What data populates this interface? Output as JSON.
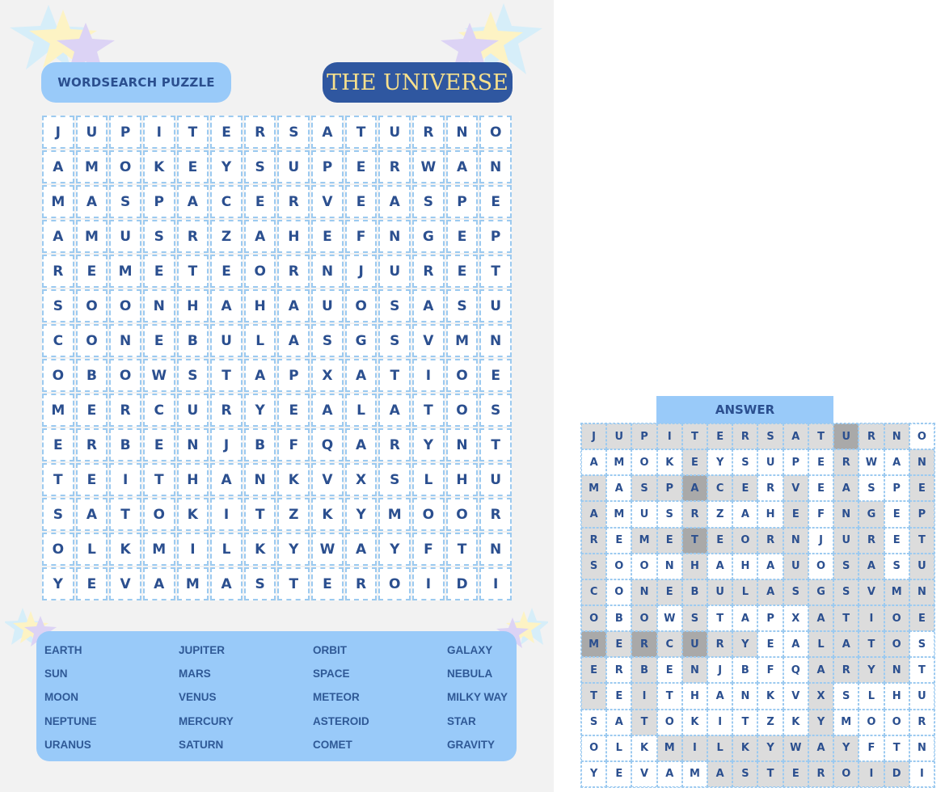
{
  "header": {
    "title": "WORDSEARCH PUZZLE",
    "theme": "THE UNIVERSE"
  },
  "colors": {
    "page_bg": "#f2f2f2",
    "pill_light": "#99caf9",
    "pill_dark": "#2f57a0",
    "theme_text": "#f7e08c",
    "letter": "#2b4f8f",
    "cell_border": "#9ccaf0",
    "highlight": "#dcdcdc",
    "highlight_overlap": "#a9a9a9",
    "star_blue": "#d6eef9",
    "star_yellow": "#fdf3c4",
    "star_purple": "#dcd3f5"
  },
  "grid": [
    [
      "J",
      "U",
      "P",
      "I",
      "T",
      "E",
      "R",
      "S",
      "A",
      "T",
      "U",
      "R",
      "N",
      "O"
    ],
    [
      "A",
      "M",
      "O",
      "K",
      "E",
      "Y",
      "S",
      "U",
      "P",
      "E",
      "R",
      "W",
      "A",
      "N"
    ],
    [
      "M",
      "A",
      "S",
      "P",
      "A",
      "C",
      "E",
      "R",
      "V",
      "E",
      "A",
      "S",
      "P",
      "E"
    ],
    [
      "A",
      "M",
      "U",
      "S",
      "R",
      "Z",
      "A",
      "H",
      "E",
      "F",
      "N",
      "G",
      "E",
      "P"
    ],
    [
      "R",
      "E",
      "M",
      "E",
      "T",
      "E",
      "O",
      "R",
      "N",
      "J",
      "U",
      "R",
      "E",
      "T"
    ],
    [
      "S",
      "O",
      "O",
      "N",
      "H",
      "A",
      "H",
      "A",
      "U",
      "O",
      "S",
      "A",
      "S",
      "U"
    ],
    [
      "C",
      "O",
      "N",
      "E",
      "B",
      "U",
      "L",
      "A",
      "S",
      "G",
      "S",
      "V",
      "M",
      "N"
    ],
    [
      "O",
      "B",
      "O",
      "W",
      "S",
      "T",
      "A",
      "P",
      "X",
      "A",
      "T",
      "I",
      "O",
      "E"
    ],
    [
      "M",
      "E",
      "R",
      "C",
      "U",
      "R",
      "Y",
      "E",
      "A",
      "L",
      "A",
      "T",
      "O",
      "S"
    ],
    [
      "E",
      "R",
      "B",
      "E",
      "N",
      "J",
      "B",
      "F",
      "Q",
      "A",
      "R",
      "Y",
      "N",
      "T"
    ],
    [
      "T",
      "E",
      "I",
      "T",
      "H",
      "A",
      "N",
      "K",
      "V",
      "X",
      "S",
      "L",
      "H",
      "U"
    ],
    [
      "S",
      "A",
      "T",
      "O",
      "K",
      "I",
      "T",
      "Z",
      "K",
      "Y",
      "M",
      "O",
      "O",
      "R"
    ],
    [
      "O",
      "L",
      "K",
      "M",
      "I",
      "L",
      "K",
      "Y",
      "W",
      "A",
      "Y",
      "F",
      "T",
      "N"
    ],
    [
      "Y",
      "E",
      "V",
      "A",
      "M",
      "A",
      "S",
      "T",
      "E",
      "R",
      "O",
      "I",
      "D",
      "I"
    ]
  ],
  "word_list": [
    "EARTH",
    "SUN",
    "MOON",
    "NEPTUNE",
    "URANUS",
    "JUPITER",
    "MARS",
    "VENUS",
    "MERCURY",
    "SATURN",
    "ORBIT",
    "SPACE",
    "METEOR",
    "ASTEROID",
    "COMET",
    "GALAXY",
    "NEBULA",
    "MILKY WAY",
    "STAR",
    "GRAVITY"
  ],
  "answer": {
    "label": "ANSWER",
    "highlight_levels": [
      [
        1,
        1,
        1,
        1,
        1,
        1,
        1,
        1,
        1,
        1,
        2,
        1,
        1,
        0
      ],
      [
        0,
        0,
        0,
        0,
        1,
        0,
        0,
        0,
        0,
        0,
        1,
        0,
        0,
        1
      ],
      [
        1,
        0,
        1,
        1,
        2,
        1,
        1,
        0,
        1,
        0,
        1,
        0,
        0,
        1
      ],
      [
        1,
        0,
        0,
        0,
        1,
        0,
        0,
        0,
        1,
        0,
        1,
        1,
        0,
        1
      ],
      [
        1,
        0,
        1,
        1,
        2,
        1,
        1,
        1,
        1,
        0,
        1,
        1,
        0,
        1
      ],
      [
        1,
        0,
        0,
        0,
        1,
        0,
        0,
        0,
        1,
        0,
        1,
        1,
        0,
        1
      ],
      [
        1,
        0,
        1,
        1,
        1,
        1,
        1,
        1,
        1,
        1,
        1,
        1,
        1,
        1
      ],
      [
        1,
        0,
        1,
        0,
        1,
        0,
        0,
        0,
        0,
        1,
        1,
        1,
        1,
        1
      ],
      [
        2,
        1,
        2,
        1,
        2,
        1,
        1,
        0,
        0,
        1,
        1,
        1,
        1,
        0
      ],
      [
        1,
        0,
        1,
        0,
        1,
        0,
        0,
        0,
        0,
        1,
        1,
        1,
        1,
        0
      ],
      [
        1,
        0,
        1,
        0,
        0,
        0,
        0,
        0,
        0,
        1,
        0,
        0,
        0,
        0
      ],
      [
        0,
        0,
        1,
        0,
        0,
        0,
        0,
        0,
        0,
        1,
        0,
        0,
        0,
        0
      ],
      [
        0,
        0,
        0,
        1,
        1,
        1,
        1,
        1,
        1,
        1,
        1,
        0,
        0,
        0
      ],
      [
        0,
        0,
        0,
        0,
        0,
        1,
        1,
        1,
        1,
        1,
        1,
        1,
        1,
        0
      ]
    ]
  }
}
